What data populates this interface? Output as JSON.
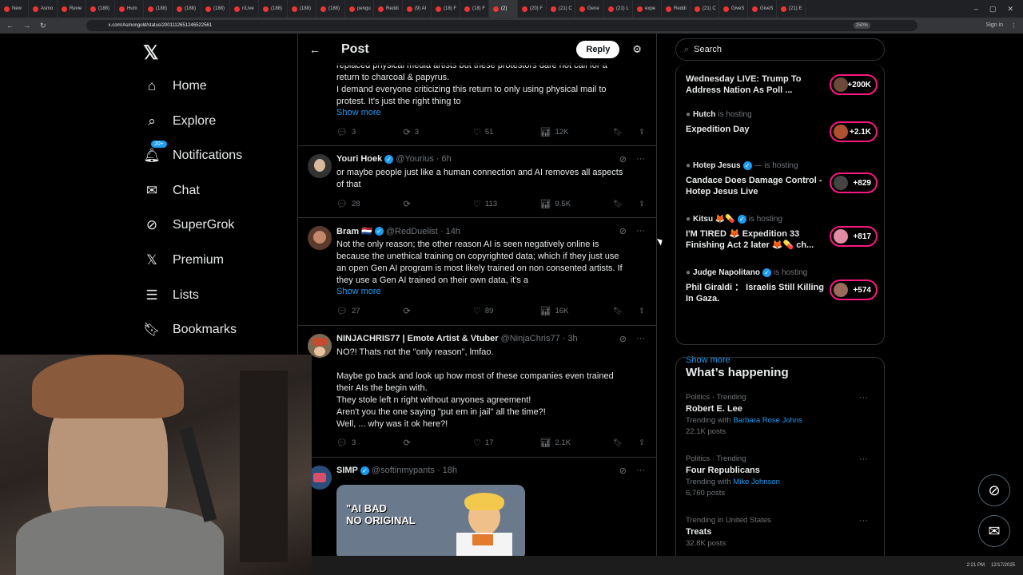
{
  "browser": {
    "tabs": [
      "New",
      "Asmo",
      "Revie",
      "(188)",
      "Hum",
      "(188)",
      "(188)",
      "(188)",
      "r/Live",
      "(188)",
      "(188)",
      "(188)",
      "pengu",
      "Reddi",
      "(9) AI",
      "(18) F",
      "(18) F",
      "(2)",
      "(20) F",
      "(21) C",
      "Gene",
      "(21) L",
      "expe",
      "Reddi",
      "(21) C",
      "GiveS",
      "GiveS",
      "(21) E"
    ],
    "url": "x.com/Asmongold/status/2001112651246522561",
    "zoom": "150%",
    "signin": "Sign in"
  },
  "nav": {
    "logo": "𝕏",
    "items": [
      {
        "label": "Home",
        "icon": "home-icon"
      },
      {
        "label": "Explore",
        "icon": "search-icon"
      },
      {
        "label": "Notifications",
        "icon": "bell-icon",
        "badge": "20+"
      },
      {
        "label": "Chat",
        "icon": "mail-icon"
      },
      {
        "label": "SuperGrok",
        "icon": "grok-icon"
      },
      {
        "label": "Premium",
        "icon": "x-icon"
      },
      {
        "label": "Lists",
        "icon": "list-icon"
      },
      {
        "label": "Bookmarks",
        "icon": "bookmark-icon"
      }
    ]
  },
  "feed": {
    "title": "Post",
    "reply_label": "Reply",
    "tweets": [
      {
        "text": "replaced physical media artists but these protestors dare not call for a\nreturn to charcoal & papyrus.\nI demand everyone criticizing this return to only using physical mail to\nprotest. It's just the right thing to",
        "show_more": "Show more",
        "replies": "3",
        "reposts": "3",
        "likes": "51",
        "views": "12K"
      },
      {
        "name": "Youri Hoek",
        "handle": "@Yourius",
        "time": "· 6h",
        "text": "or maybe people just like a human connection and AI removes all aspects\nof that",
        "replies": "28",
        "reposts": "",
        "likes": "113",
        "views": "9.5K"
      },
      {
        "name": "Bram 🇳🇱",
        "handle": "@RedDuelist",
        "time": "· 14h",
        "text": "Not the only reason; the other reason AI is seen negatively online is\nbecause the unethical training on copyrighted data; which if they just use\nan open Gen AI program is most likely trained on non consented artists. If\nthey use a Gen AI trained on their own data, it's a",
        "show_more": "Show more",
        "replies": "27",
        "reposts": "",
        "likes": "89",
        "views": "16K"
      },
      {
        "name": "NINJACHRIS77 | Emote Artist & Vtuber",
        "handle": "@NinjaChris77",
        "time": "· 3h",
        "text": "NO?! Thats not the \"only reason\", lmfao.\n\nMaybe go back and look up how most of these companies even trained\ntheir AIs the begin with.\nThey stole left n right without anyones agreement!\nAren't you the one saying \"put em in jail\" all the time?!\nWell, ... why was it ok here?!",
        "replies": "3",
        "reposts": "",
        "likes": "17",
        "views": "2.1K"
      },
      {
        "name": "SIMP",
        "handle": "@softinmypants",
        "time": "· 18h",
        "meme_text": "\"AI BAD\nNO ORIGINAL"
      }
    ]
  },
  "right": {
    "search_placeholder": "Search",
    "spaces": [
      {
        "host": "",
        "status": "",
        "title": "Wednesday LIVE: Trump To Address Nation As Poll ...",
        "count": "+200K"
      },
      {
        "host": "Hutch",
        "status": "is hosting",
        "title": "Expedition Day",
        "count": "+2.1K"
      },
      {
        "host": "Hotep Jesus",
        "status": "— is hosting",
        "title": "Candace Does Damage Control - Hotep Jesus Live",
        "count": "+829"
      },
      {
        "host": "Kitsu 🦊💊",
        "status": "is hosting",
        "title": "I'M TIRED 🦊 Expedition 33 Finishing Act 2 later 🦊💊 ch...",
        "count": "+817"
      },
      {
        "host": "Judge Napolitano",
        "status": "is hosting",
        "title": "Phil Giraldi ： Israelis Still Killing In Gaza.",
        "count": "+574"
      }
    ],
    "show_more": "Show more",
    "happening_title": "What’s happening",
    "trends": [
      {
        "category": "Politics · Trending",
        "name": "Robert E. Lee",
        "with_prefix": "Trending with",
        "with": "Barbara Rose Johns",
        "posts": "22.1K posts"
      },
      {
        "category": "Politics · Trending",
        "name": "Four Republicans",
        "with_prefix": "Trending with",
        "with": "Mike Johnson",
        "posts": "6,760 posts"
      },
      {
        "category": "Trending in United States",
        "name": "Treats",
        "with_prefix": "",
        "with": "",
        "posts": "32.8K posts"
      }
    ]
  },
  "taskbar": {
    "time": "2:21 PM",
    "date": "12/17/2025"
  }
}
